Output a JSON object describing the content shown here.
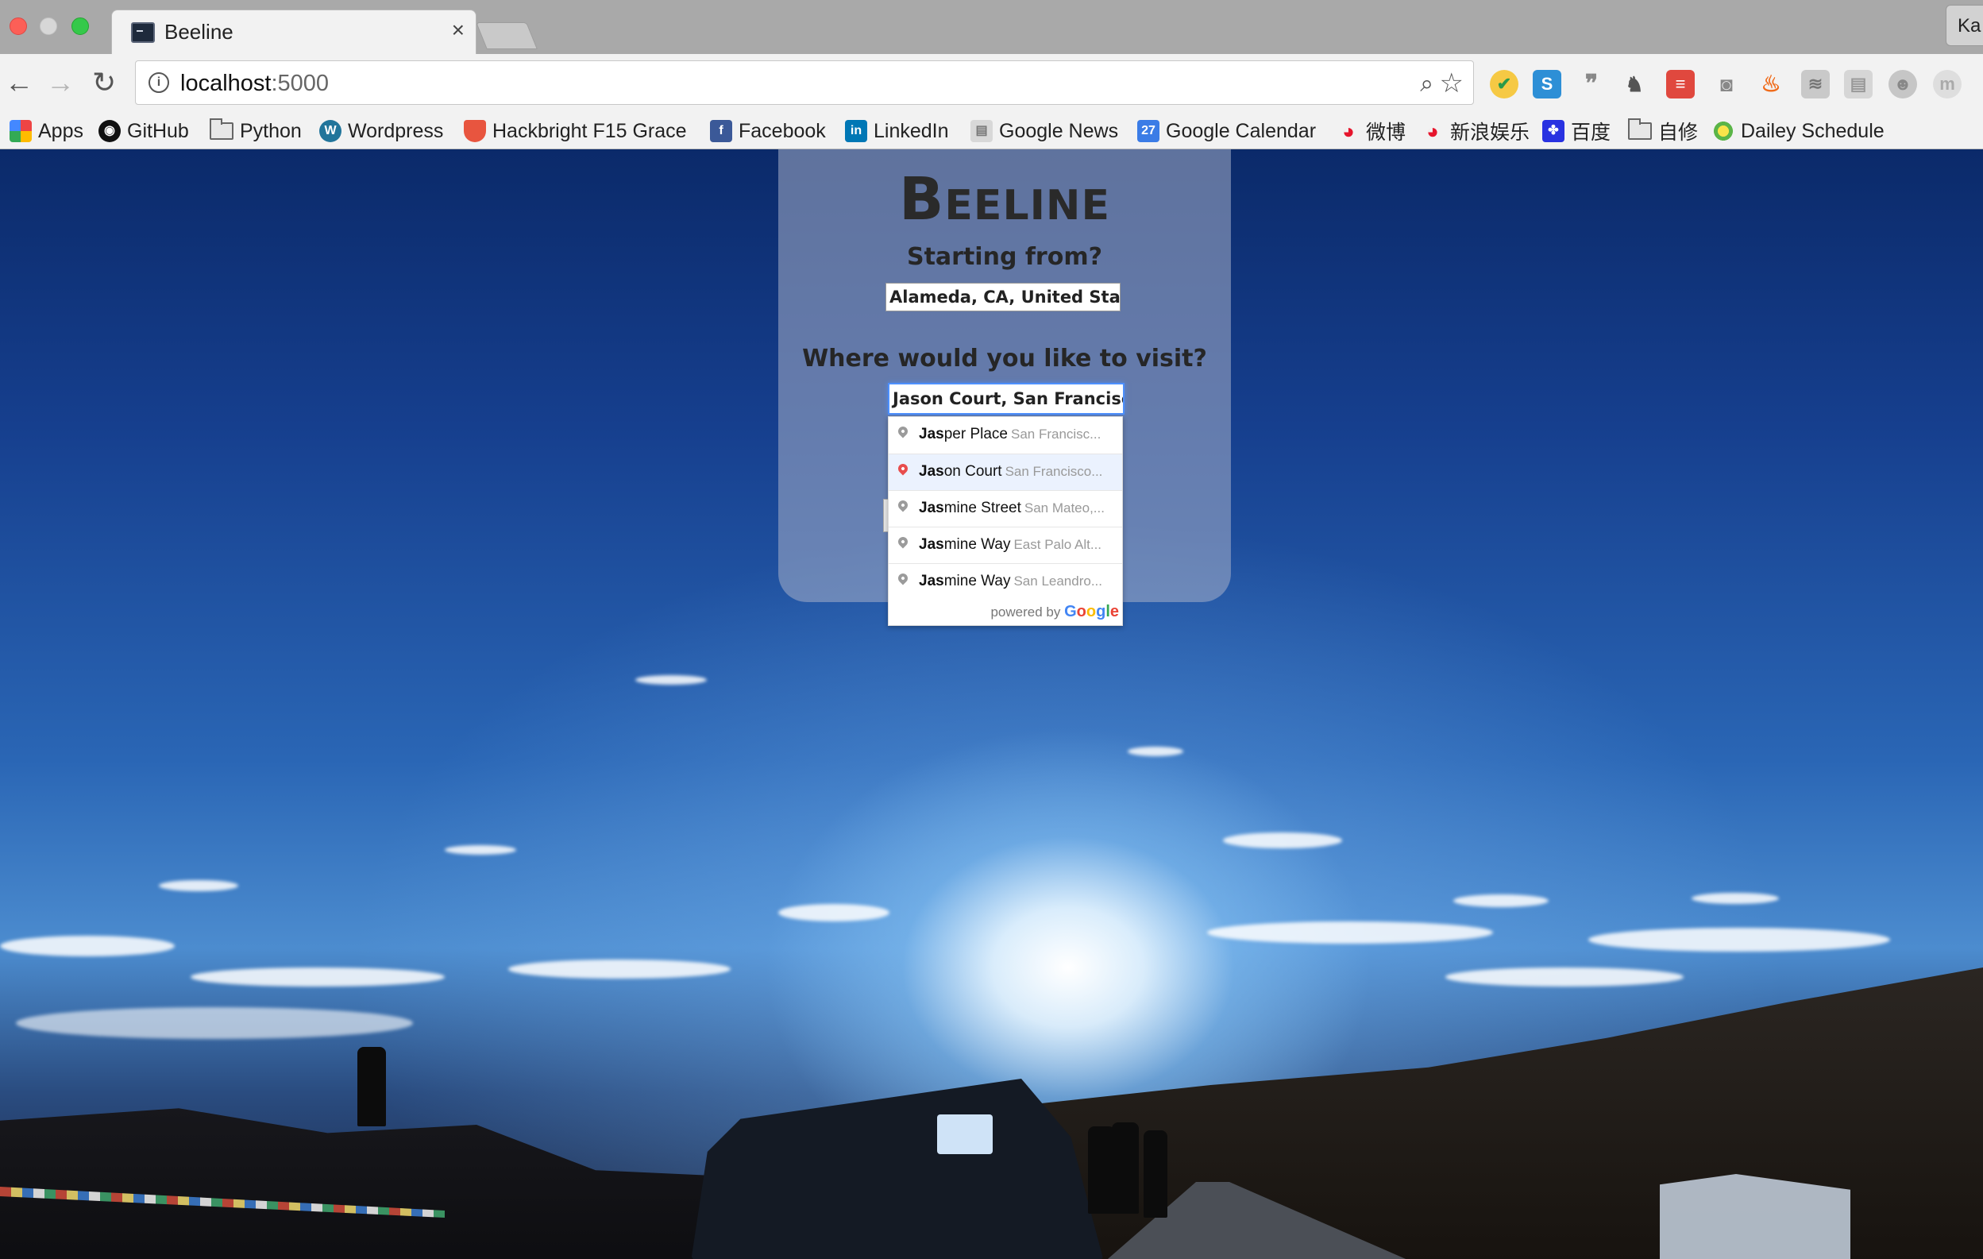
{
  "browser": {
    "tab_title": "Beeline",
    "tab_close": "×",
    "url_host": "localhost",
    "url_port": ":5000",
    "profile_label": "Ka",
    "bookmarks": [
      {
        "label": "Apps",
        "icon": "apps-grid-icon"
      },
      {
        "label": "GitHub",
        "icon": "github-icon"
      },
      {
        "label": "Python",
        "icon": "folder-icon"
      },
      {
        "label": "Wordpress",
        "icon": "wordpress-icon"
      },
      {
        "label": "Hackbright F15 Grace",
        "icon": "hackbright-icon"
      },
      {
        "label": "Facebook",
        "icon": "facebook-icon"
      },
      {
        "label": "LinkedIn",
        "icon": "linkedin-icon"
      },
      {
        "label": "Google News",
        "icon": "google-news-icon"
      },
      {
        "label": "Google Calendar",
        "icon": "google-calendar-icon"
      },
      {
        "label": "微博",
        "icon": "weibo-icon"
      },
      {
        "label": "新浪娱乐",
        "icon": "sina-icon"
      },
      {
        "label": "百度",
        "icon": "baidu-icon"
      },
      {
        "label": "自修",
        "icon": "folder-icon"
      },
      {
        "label": "Dailey Schedule",
        "icon": "schedule-icon"
      }
    ],
    "calendar_day": "27"
  },
  "app": {
    "brand": "Beeline",
    "start_heading": "Starting from?",
    "start_value": "Alameda, CA, United States",
    "visit_heading": "Where would you like to visit?",
    "visit_value": "Jason Court, San Francisco, CA"
  },
  "autocomplete": {
    "items": [
      {
        "match": "Jas",
        "rest": "per Place",
        "secondary": "San Francisc..."
      },
      {
        "match": "Jas",
        "rest": "on Court",
        "secondary": "San Francisco..."
      },
      {
        "match": "Jas",
        "rest": "mine Street",
        "secondary": "San Mateo,..."
      },
      {
        "match": "Jas",
        "rest": "mine Way",
        "secondary": "East Palo Alt..."
      },
      {
        "match": "Jas",
        "rest": "mine Way",
        "secondary": "San Leandro..."
      }
    ],
    "powered_by": "powered by",
    "google": [
      "G",
      "o",
      "o",
      "g",
      "l",
      "e"
    ]
  }
}
